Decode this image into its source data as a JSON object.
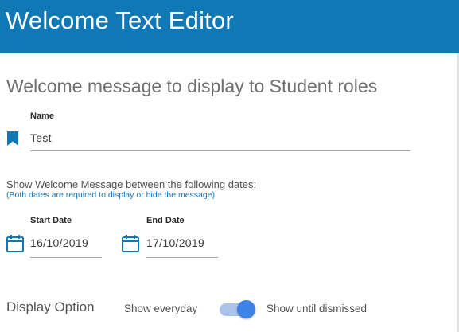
{
  "header": {
    "title": "Welcome Text Editor"
  },
  "section": {
    "title": "Welcome message to display to Student roles"
  },
  "name_field": {
    "label": "Name",
    "value": "Test",
    "icon": "bookmark-icon"
  },
  "dates": {
    "prompt": "Show Welcome Message between the following dates:",
    "note": "(Both dates are required to display or hide the message)",
    "start": {
      "label": "Start Date",
      "value": "16/10/2019",
      "icon": "calendar-icon"
    },
    "end": {
      "label": "End Date",
      "value": "17/10/2019",
      "icon": "calendar-icon"
    }
  },
  "display_option": {
    "label": "Display Option",
    "left_option": "Show everyday",
    "right_option": "Show until dismissed",
    "toggle_on": true
  },
  "colors": {
    "header_bg": "#0f78b5",
    "accent": "#1a73b5",
    "toggle_thumb": "#3c83e6",
    "toggle_track": "#a9c4ec"
  }
}
